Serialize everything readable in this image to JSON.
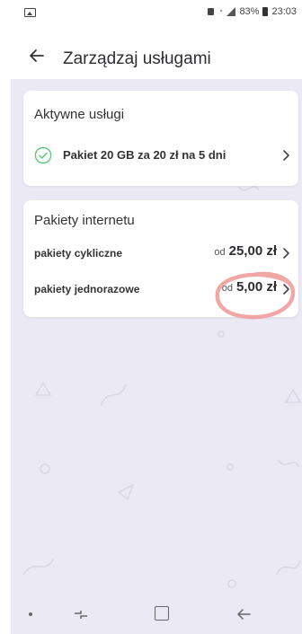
{
  "status_bar": {
    "battery": "83%",
    "time": "23:03"
  },
  "header": {
    "title": "Zarządzaj usługami"
  },
  "active_services": {
    "title": "Aktywne usługi",
    "items": [
      {
        "label": "Pakiet 20 GB za 20 zł na 5 dni"
      }
    ]
  },
  "internet_packages": {
    "title": "Pakiety internetu",
    "items": [
      {
        "label": "pakiety cykliczne",
        "price_prefix": "od",
        "price": "25,00 zł"
      },
      {
        "label": "pakiety jednorazowe",
        "price_prefix": "od",
        "price": "5,00 zł"
      }
    ]
  },
  "colors": {
    "accent_green": "#5cc877",
    "annotation_red": "#f09898",
    "background": "#ebeaf4"
  }
}
